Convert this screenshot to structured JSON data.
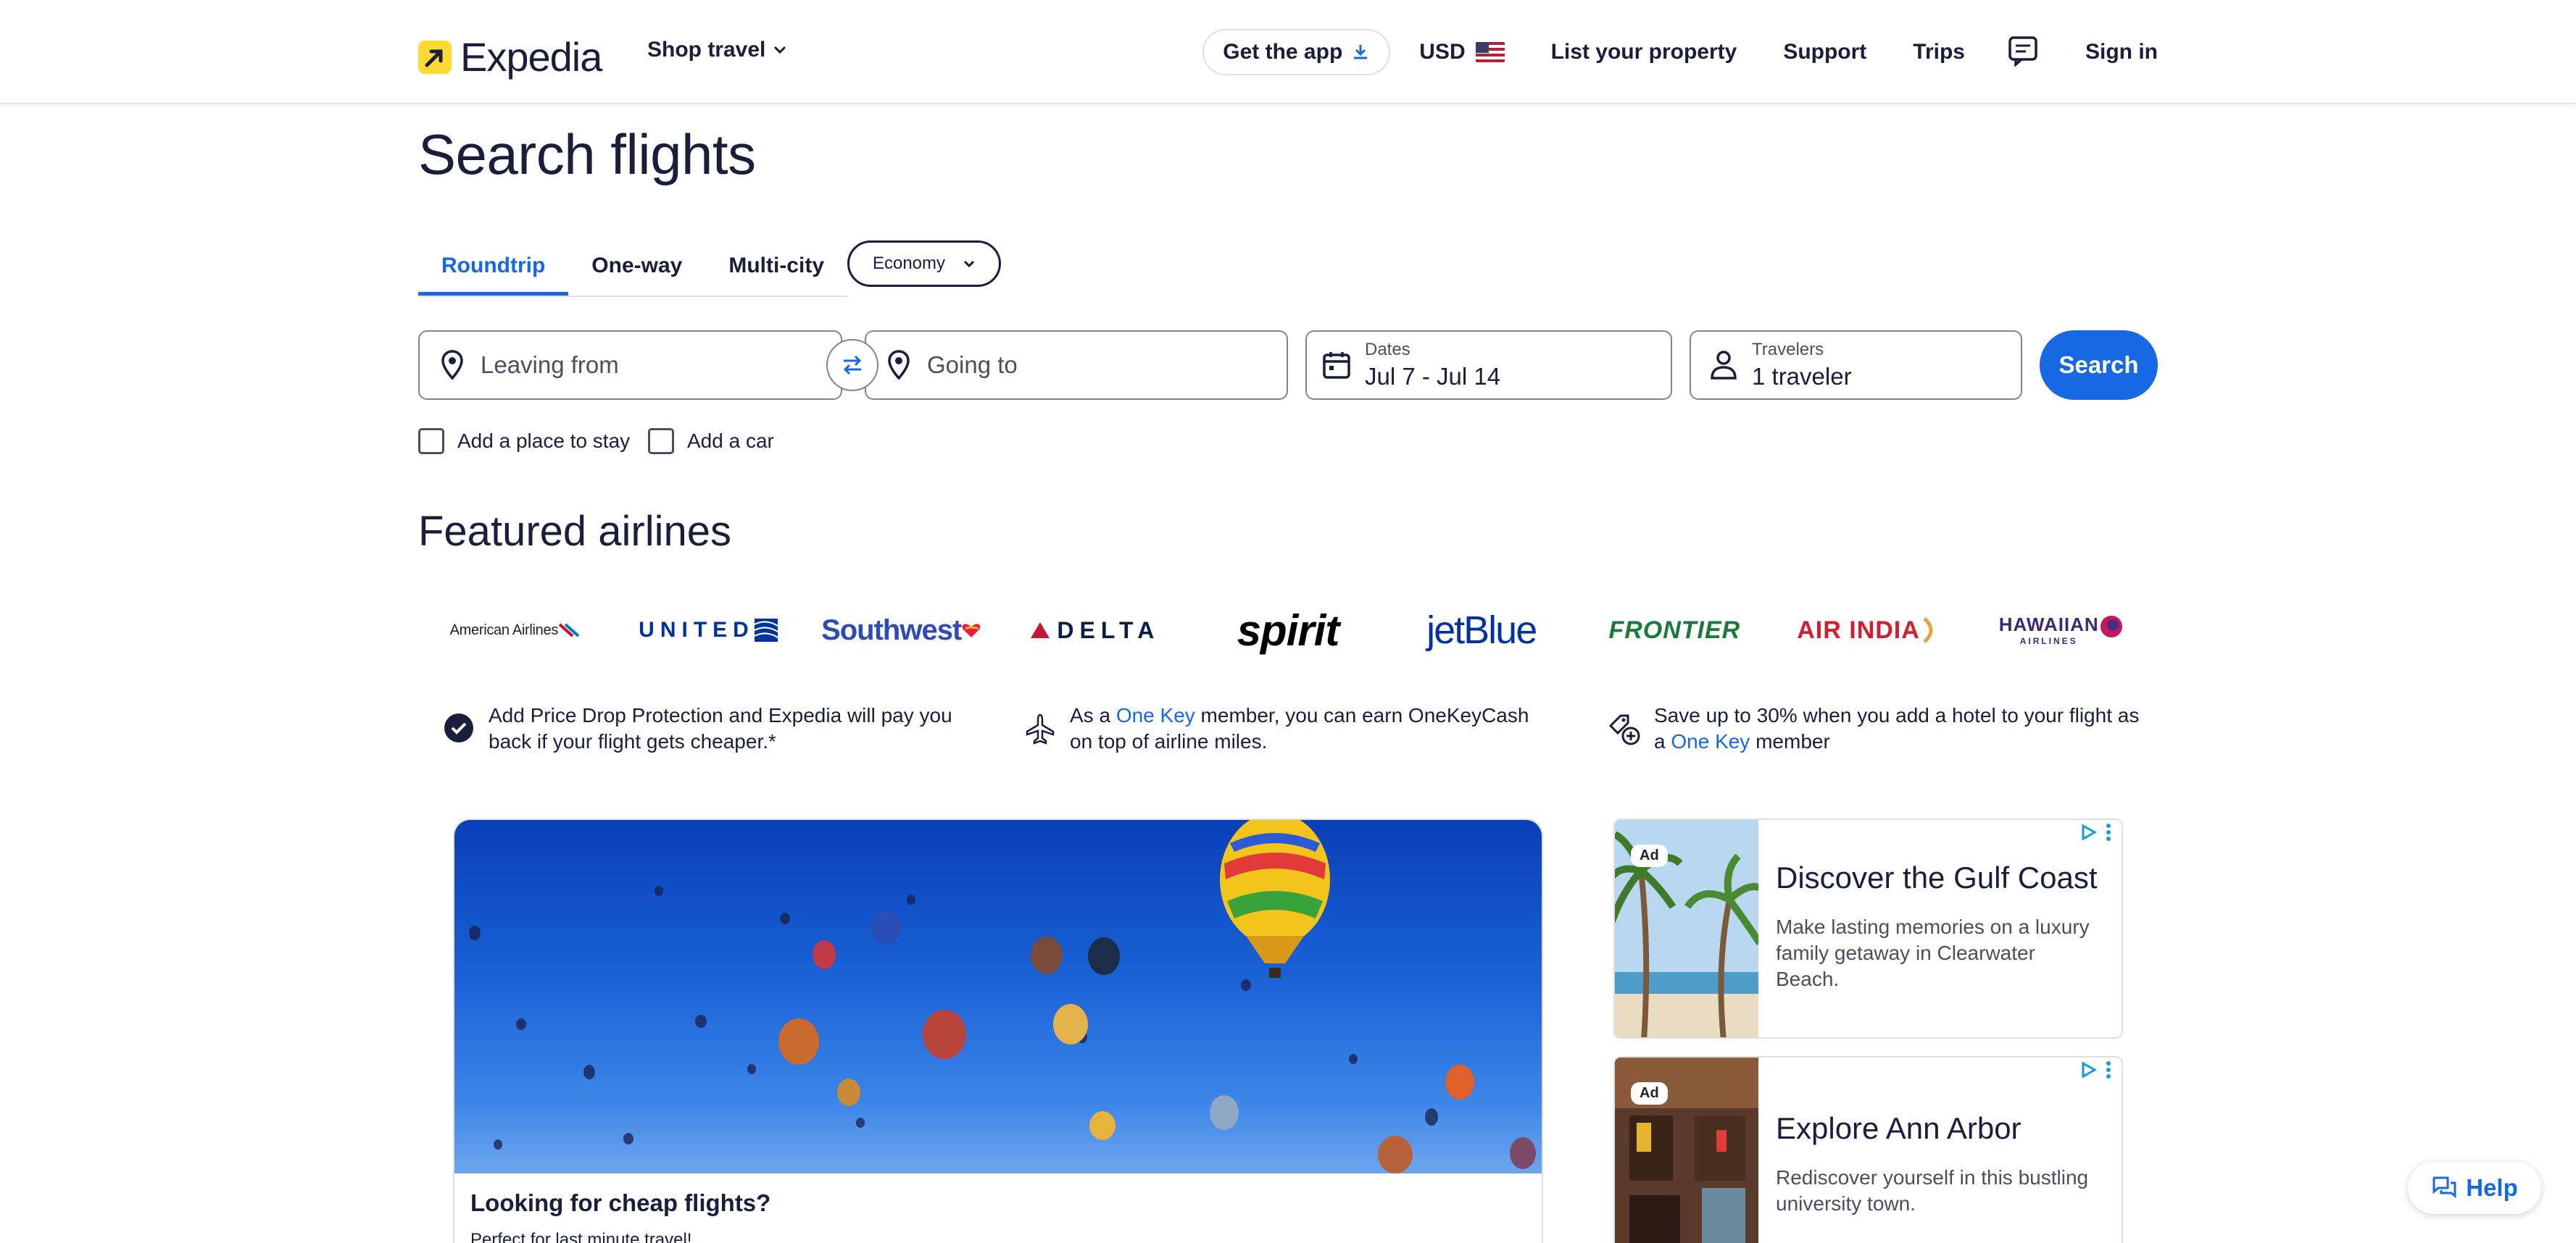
{
  "header": {
    "logo_text": "Expedia",
    "shop_travel": "Shop travel",
    "get_app": "Get the app",
    "currency": "USD",
    "list_property": "List your property",
    "support": "Support",
    "trips": "Trips",
    "sign_in": "Sign in"
  },
  "page": {
    "title": "Search flights"
  },
  "tabs": [
    {
      "label": "Roundtrip",
      "active": true
    },
    {
      "label": "One-way",
      "active": false
    },
    {
      "label": "Multi-city",
      "active": false
    }
  ],
  "cabin_class": "Economy",
  "search": {
    "leaving_placeholder": "Leaving from",
    "going_placeholder": "Going to",
    "dates_label": "Dates",
    "dates_value": "Jul 7 - Jul 14",
    "travelers_label": "Travelers",
    "travelers_value": "1 traveler",
    "button": "Search"
  },
  "addons": {
    "stay": "Add a place to stay",
    "car": "Add a car"
  },
  "featured": {
    "title": "Featured airlines",
    "airlines": [
      "American Airlines",
      "UNITED",
      "Southwest",
      "DELTA",
      "spirit",
      "jetBlue",
      "FRONTIER",
      "AIR INDIA",
      "HAWAIIAN",
      "AIRLINES"
    ]
  },
  "benefits": {
    "price_drop": "Add Price Drop Protection and Expedia will pay you back if your flight gets cheaper.*",
    "onekey_pre": "As a ",
    "onekey_link": "One Key",
    "onekey_post": " member, you can earn OneKeyCash on top of airline miles.",
    "hotel_pre": "Save up to 30% when you add a hotel to your flight as a ",
    "hotel_link": "One Key",
    "hotel_post": " member"
  },
  "hero": {
    "title": "Looking for cheap flights?",
    "subtitle": "Perfect for last minute travel!"
  },
  "ads": [
    {
      "badge": "Ad",
      "title": "Discover the Gulf Coast",
      "body": "Make lasting memories on a luxury family getaway in Clearwater Beach."
    },
    {
      "badge": "Ad",
      "title": "Explore Ann Arbor",
      "body": "Rediscover yourself in this bustling university town."
    }
  ],
  "help": "Help",
  "colors": {
    "primary": "#1668e3",
    "brand_yellow": "#fddb32",
    "text": "#191e3b"
  }
}
